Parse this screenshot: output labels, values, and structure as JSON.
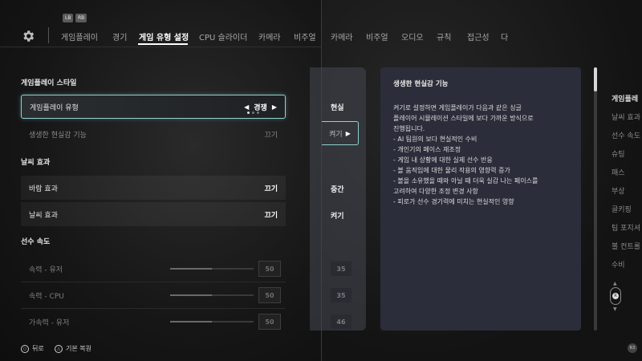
{
  "left": {
    "bumpers": {
      "left": "LB",
      "right": "RB"
    },
    "nav": {
      "tabs": [
        "게임플레이",
        "경기",
        "게임 유형 설정",
        "CPU 슬라이더",
        "카메라",
        "비주얼"
      ],
      "active_index": 2
    },
    "sections": {
      "gameplay_style": "게임플레이 스타일",
      "weather": "날씨 효과",
      "player_speed": "선수 속도"
    },
    "rows": {
      "gameplay_type": {
        "label": "게임플레이 유형",
        "value": "경쟁"
      },
      "realism": {
        "label": "생생한 현실감 기능",
        "value": "끄기"
      },
      "wind": {
        "label": "바람 효과",
        "value": "끄기"
      },
      "weather": {
        "label": "날씨 효과",
        "value": "끄기"
      }
    },
    "sliders": [
      {
        "label": "속력 - 유저",
        "value": "50",
        "fraction": 0.5
      },
      {
        "label": "속력 - CPU",
        "value": "50",
        "fraction": 0.5
      },
      {
        "label": "가속력 - 유저",
        "value": "50",
        "fraction": 0.5
      }
    ],
    "hints": {
      "back": "뒤로",
      "reset": "기본 복원"
    }
  },
  "right": {
    "nav": [
      "카메라",
      "비주얼",
      "오디오",
      "규칙",
      "접근성",
      "다"
    ],
    "ghost": {
      "gameplay_type": "현실",
      "realism": "켜기",
      "wind": "중간",
      "weather": "켜기",
      "num1": "35",
      "num2": "35",
      "num3": "46"
    },
    "info": {
      "title": "생생한 현실감 기능",
      "intro1": "켜기로 설정하면 게임플레이가 다음과 같은 싱글",
      "intro2": "플레이어 시뮬레이션 스타일에 보다 가까운 방식으로",
      "intro3": "진행됩니다.",
      "b1": "- AI 팀원의 보다 현실적인 수비",
      "b2": "- 개인기의 페이스 재조정",
      "b3": "- 게임 내 상황에 대한 실제 선수 반응",
      "b4": "- 볼 움직임에 대한 물리 작용의 영향력 증가",
      "b5a": "- 볼을 소유했을 때와 아닐 때 더욱 실감 나는 페이스를",
      "b5b": "고려하여 다양한 조정 변경 사항",
      "b6": "- 피로가 선수 경기력에 미치는 현실적인 영향"
    },
    "side_list": [
      "게임플레",
      "날씨 효과",
      "선수 속도",
      "슈팅",
      "패스",
      "부상",
      "골키핑",
      "팀 포지셔",
      "볼 컨트롤",
      "수비"
    ],
    "ring_label": "R",
    "corner_hint": "R3"
  }
}
